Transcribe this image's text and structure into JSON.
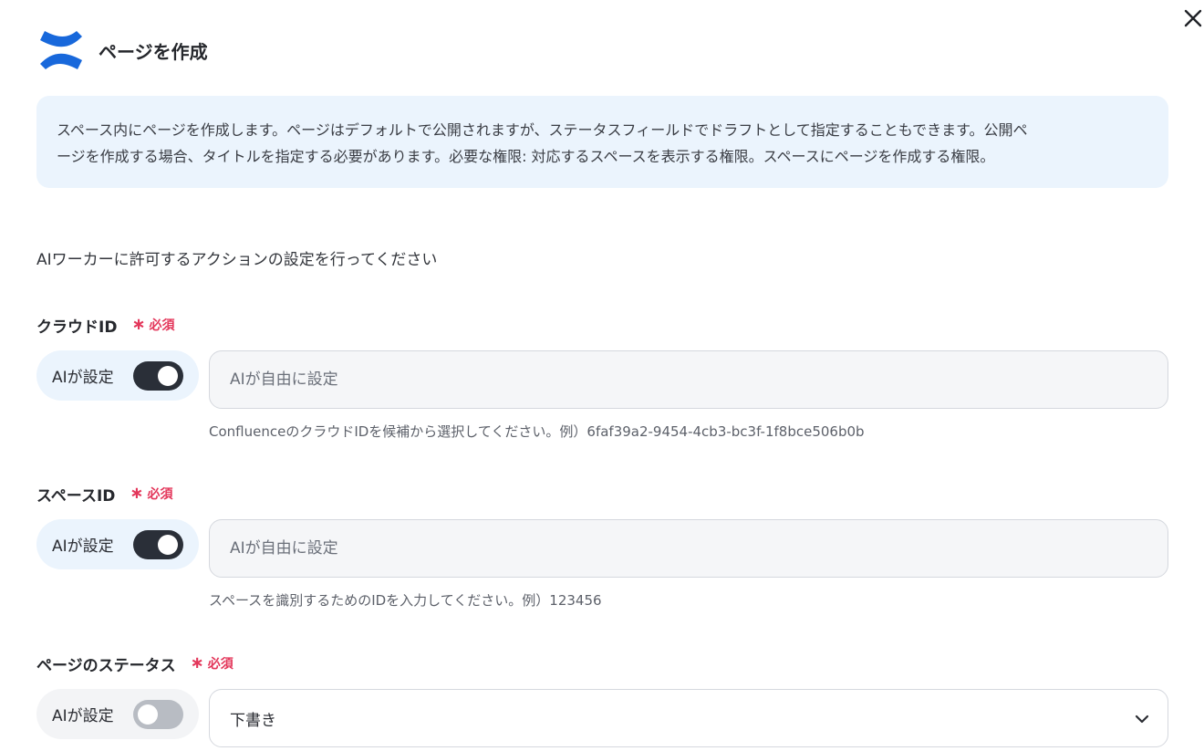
{
  "header": {
    "title": "ページを作成",
    "logo_icon": "confluence-logo",
    "close_icon": "close-icon"
  },
  "description": {
    "line1": "スペース内にページを作成します。ページはデフォルトで公開されますが、ステータスフィールドでドラフトとして指定することもできます。公開ペ",
    "line2": "ージを作成する場合、タイトルを指定する必要があります。必要な権限: 対応するスペースを表示する権限。スペースにページを作成する権限。"
  },
  "instruction": "AIワーカーに許可するアクションの設定を行ってください",
  "fields": [
    {
      "label": "クラウドID",
      "required_label": "必須",
      "ai_label": "AIが設定",
      "ai_enabled": true,
      "placeholder": "AIが自由に設定",
      "hint": "ConfluenceのクラウドIDを候補から選択してください。例）6faf39a2-9454-4cb3-bc3f-1f8bce506b0b"
    },
    {
      "label": "スペースID",
      "required_label": "必須",
      "ai_label": "AIが設定",
      "ai_enabled": true,
      "placeholder": "AIが自由に設定",
      "hint": "スペースを識別するためのIDを入力してください。例）123456"
    },
    {
      "label": "ページのステータス",
      "required_label": "必須",
      "ai_label": "AIが設定",
      "ai_enabled": false,
      "selected": "下書き"
    }
  ],
  "colors": {
    "accent_blue": "#1868db",
    "required_red": "#e3365a",
    "panel_bg": "#ebf4fd",
    "toggle_on": "#2a2f38",
    "toggle_off": "#b8bcc3"
  }
}
